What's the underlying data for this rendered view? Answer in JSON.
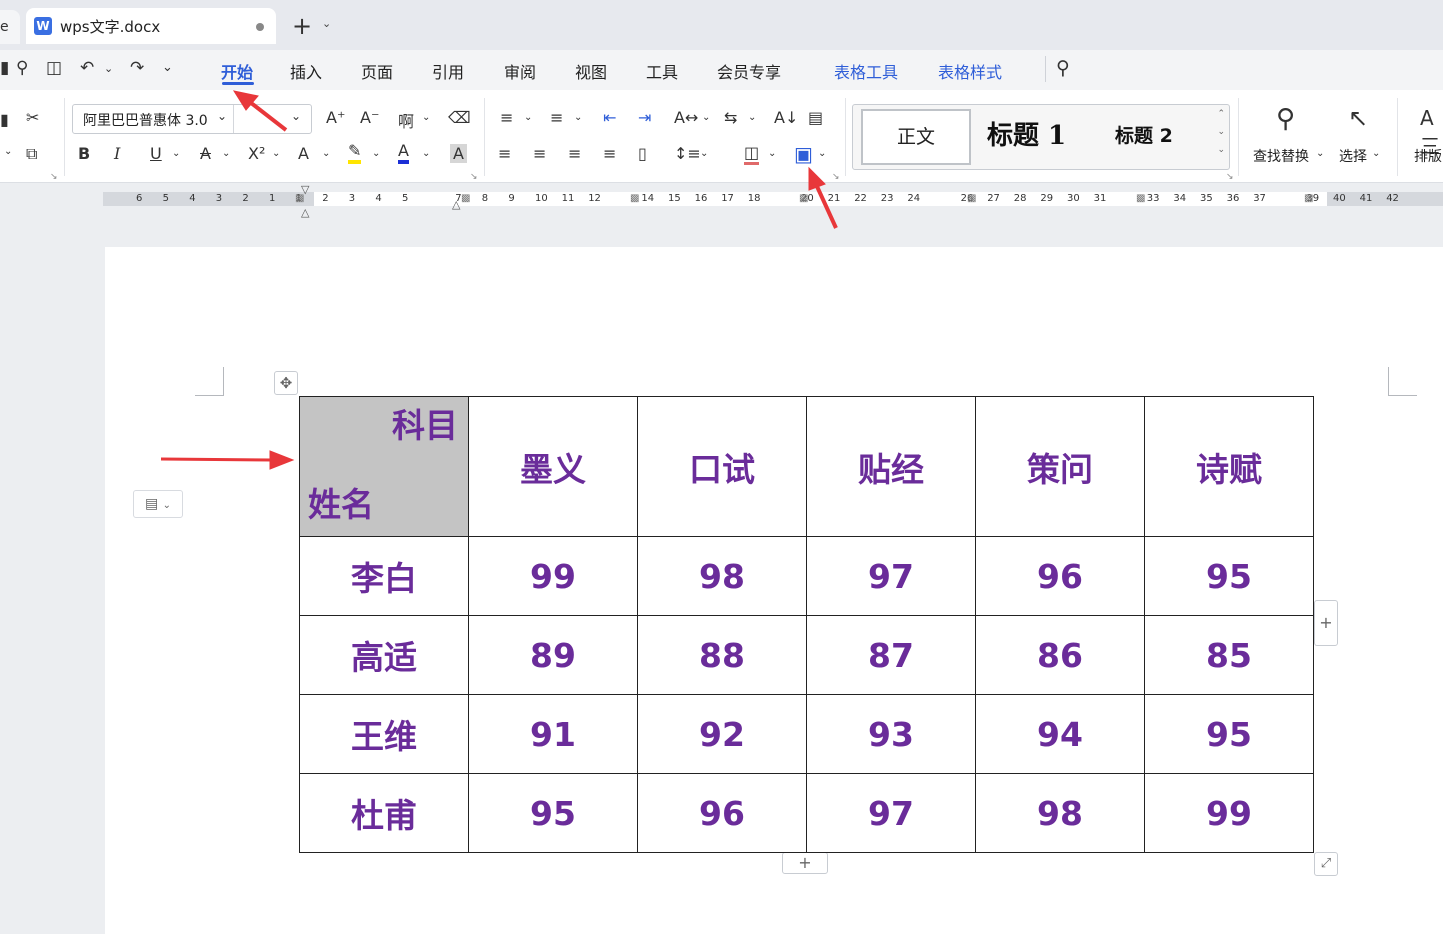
{
  "tabs": {
    "stub_label": "e",
    "document_title": "wps文字.docx",
    "doc_icon_letter": "W",
    "new_tab_symbol": "+"
  },
  "menu": {
    "items": [
      "开始",
      "插入",
      "页面",
      "引用",
      "审阅",
      "视图",
      "工具",
      "会员专享",
      "表格工具",
      "表格样式"
    ],
    "active": "开始"
  },
  "ribbon": {
    "font_name": "阿里巴巴普惠体 3.0",
    "style_normal": "正文",
    "style_h1": "标题  1",
    "style_h2": "标题  2",
    "find_replace": "查找替换",
    "select": "选择",
    "layout": "排版",
    "layout_icon_text": "A三"
  },
  "ruler": {
    "ticks": [
      "6",
      "5",
      "4",
      "3",
      "2",
      "1",
      "1",
      "2",
      "3",
      "4",
      "5",
      "7",
      "8",
      "9",
      "10",
      "11",
      "12",
      "14",
      "15",
      "16",
      "17",
      "18",
      "20",
      "21",
      "22",
      "23",
      "24",
      "26",
      "27",
      "28",
      "29",
      "30",
      "31",
      "33",
      "34",
      "35",
      "36",
      "37",
      "39",
      "40",
      "41",
      "42"
    ]
  },
  "table": {
    "header_diag_top": "科目",
    "header_diag_bottom": "姓名",
    "columns": [
      "墨义",
      "口试",
      "贴经",
      "策问",
      "诗赋"
    ],
    "rows": [
      {
        "name": "李白",
        "scores": [
          "99",
          "98",
          "97",
          "96",
          "95"
        ]
      },
      {
        "name": "高适",
        "scores": [
          "89",
          "88",
          "87",
          "86",
          "85"
        ]
      },
      {
        "name": "王维",
        "scores": [
          "91",
          "92",
          "93",
          "94",
          "95"
        ]
      },
      {
        "name": "杜甫",
        "scores": [
          "95",
          "96",
          "97",
          "98",
          "99"
        ]
      }
    ]
  },
  "colors": {
    "accent": "#2f5ed8",
    "table_text": "#6a2c9a",
    "header_fill": "#c4c4c4",
    "annotation_arrow": "#e8373a"
  }
}
